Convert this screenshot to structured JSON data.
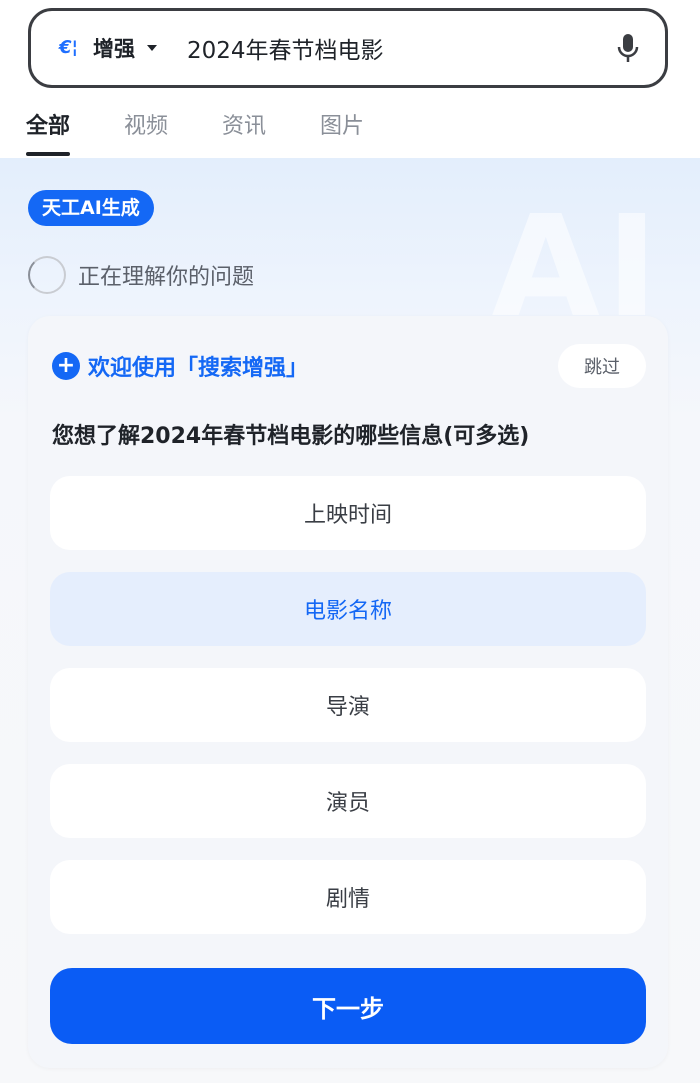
{
  "search": {
    "mode_label": "增强",
    "query": "2024年春节档电影"
  },
  "tabs": [
    {
      "label": "全部",
      "active": true
    },
    {
      "label": "视频",
      "active": false
    },
    {
      "label": "资讯",
      "active": false
    },
    {
      "label": "图片",
      "active": false
    }
  ],
  "ai": {
    "badge": "天工AI生成",
    "watermark": "AI",
    "status": "正在理解你的问题"
  },
  "card": {
    "welcome": "欢迎使用「搜索增强」",
    "skip_label": "跳过",
    "question": "您想了解2024年春节档电影的哪些信息(可多选)",
    "options": [
      {
        "label": "上映时间",
        "selected": false
      },
      {
        "label": "电影名称",
        "selected": true
      },
      {
        "label": "导演",
        "selected": false
      },
      {
        "label": "演员",
        "selected": false
      },
      {
        "label": "剧情",
        "selected": false
      }
    ],
    "next_label": "下一步"
  },
  "colors": {
    "accent": "#1468f5",
    "primary_button": "#0a5cf5",
    "selected_bg": "#e5eefd"
  },
  "icons": {
    "mode": "ai-enhance-icon",
    "mic": "microphone-icon",
    "status": "loading-spinner-icon",
    "welcome": "plus-circle-icon"
  }
}
